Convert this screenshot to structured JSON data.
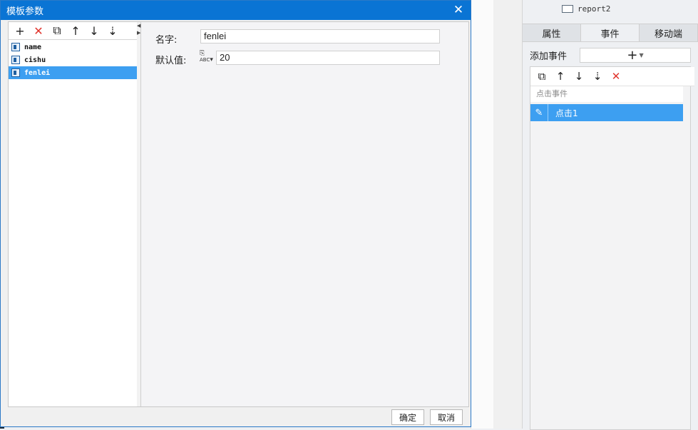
{
  "dialog": {
    "title": "模板参数",
    "close_icon": "close-icon",
    "toolbar": {
      "add": "+",
      "delete": "✕",
      "copy": "⧉",
      "move_up": "↑",
      "move_down": "↓",
      "sort": "⇣"
    },
    "params": [
      "name",
      "cishu",
      "fenlei"
    ],
    "selected_param": "fenlei",
    "name_label": "名字:",
    "name_value": "fenlei",
    "default_label": "默认值:",
    "default_type_icon": "ABC",
    "default_value": "20",
    "ok_label": "确定",
    "cancel_label": "取消"
  },
  "right_panel": {
    "tree_item": "report2",
    "tabs": [
      "属性",
      "事件",
      "移动端"
    ],
    "active_tab": "事件",
    "add_event_label": "添加事件",
    "add_event_icon": "+",
    "event_list_header": "点击事件",
    "events": [
      "点击1"
    ]
  },
  "colors": {
    "title_bar": "#0a74d4",
    "selection": "#3d9ff1",
    "delete_red": "#e0342c"
  }
}
